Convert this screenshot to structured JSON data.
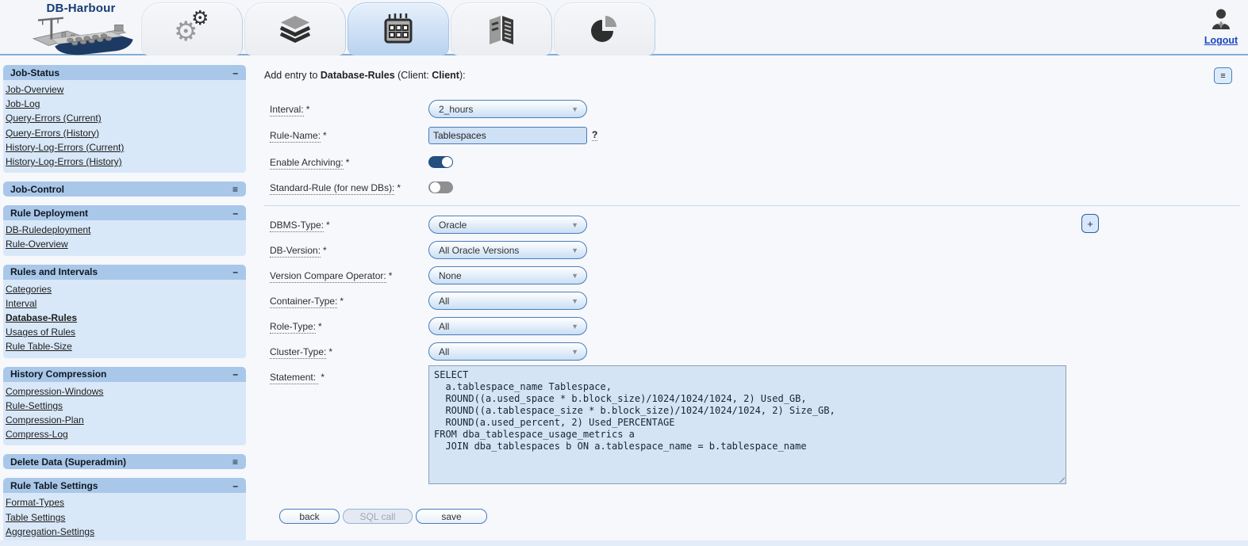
{
  "app": {
    "logo_title": "DB-Harbour",
    "logout_label": "Logout"
  },
  "icons": {
    "dropdown_arrow": "▼",
    "gear": "⚙"
  },
  "tabs": [
    {
      "name": "settings",
      "icon": "gears-icon",
      "active": false
    },
    {
      "name": "layers",
      "icon": "layers-icon",
      "active": false
    },
    {
      "name": "scheduler",
      "icon": "calendar-icon",
      "active": true
    },
    {
      "name": "ledger",
      "icon": "ledger-icon",
      "active": false
    },
    {
      "name": "statistics",
      "icon": "pie-chart-icon",
      "active": false
    }
  ],
  "sidebar": {
    "sections": [
      {
        "title": "Job-Status",
        "toggle": "–",
        "state": "expanded",
        "items": [
          "Job-Overview",
          "Job-Log",
          "Query-Errors (Current)",
          "Query-Errors (History)",
          "History-Log-Errors (Current)",
          "History-Log-Errors (History)"
        ]
      },
      {
        "title": "Job-Control",
        "toggle": "≡",
        "state": "collapsed",
        "items": []
      },
      {
        "title": "Rule Deployment",
        "toggle": "–",
        "state": "expanded",
        "items": [
          "DB-Ruledeployment",
          "Rule-Overview"
        ]
      },
      {
        "title": "Rules and Intervals",
        "toggle": "–",
        "state": "expanded",
        "items": [
          "Categories",
          "Interval",
          "Database-Rules",
          "Usages of Rules",
          "Rule Table-Size"
        ],
        "active_item": "Database-Rules"
      },
      {
        "title": "History Compression",
        "toggle": "–",
        "state": "expanded",
        "items": [
          "Compression-Windows",
          "Rule-Settings",
          "Compression-Plan",
          "Compress-Log"
        ]
      },
      {
        "title": "Delete Data (Superadmin)",
        "toggle": "≡",
        "state": "collapsed",
        "items": []
      },
      {
        "title": "Rule Table Settings",
        "toggle": "–",
        "state": "expanded",
        "items": [
          "Format-Types",
          "Table Settings",
          "Aggregation-Settings"
        ]
      }
    ]
  },
  "main": {
    "title": {
      "prefix": "Add entry to ",
      "entity": "Database-Rules",
      "mid": " (Client: ",
      "client": "Client",
      "suffix": "):"
    },
    "menu_button": "≡",
    "add_button": "+",
    "fields": {
      "interval": {
        "label": "Interval:",
        "required": "*",
        "value": "2_hours"
      },
      "rule_name": {
        "label": "Rule-Name:",
        "required": "*",
        "value": "Tablespaces",
        "help": "?"
      },
      "enable_archiving": {
        "label": "Enable Archiving:",
        "required": "*",
        "on": true
      },
      "standard_rule": {
        "label": "Standard-Rule (for new DBs):",
        "required": "*",
        "on": false
      },
      "dbms_type": {
        "label": "DBMS-Type:",
        "required": "*",
        "value": "Oracle"
      },
      "db_version": {
        "label": "DB-Version:",
        "required": "*",
        "value": "All Oracle Versions"
      },
      "version_compare_operator": {
        "label": "Version Compare Operator:",
        "required": "*",
        "value": "None"
      },
      "container_type": {
        "label": "Container-Type:",
        "required": "*",
        "value": "All"
      },
      "role_type": {
        "label": "Role-Type:",
        "required": "*",
        "value": "All"
      },
      "cluster_type": {
        "label": "Cluster-Type:",
        "required": "*",
        "value": "All"
      },
      "statement": {
        "label": "Statement: ",
        "required": "*",
        "value": "SELECT\n  a.tablespace_name Tablespace,\n  ROUND((a.used_space * b.block_size)/1024/1024/1024, 2) Used_GB,\n  ROUND((a.tablespace_size * b.block_size)/1024/1024/1024, 2) Size_GB,\n  ROUND(a.used_percent, 2) Used_PERCENTAGE\nFROM dba_tablespace_usage_metrics a\n  JOIN dba_tablespaces b ON a.tablespace_name = b.tablespace_name"
      }
    },
    "buttons": {
      "back": "back",
      "sql_call": "SQL call",
      "save": "save"
    }
  },
  "colors": {
    "accent_border": "#4a7cb8",
    "header_divider": "#84add7",
    "sidebar_header_bg": "#a9c7e9",
    "sidebar_body_bg": "#d9e8f8",
    "active_tab_bg": "#b8d2ef",
    "field_bg": "#cfe1f4",
    "statement_bg": "#d5e4f5",
    "toggle_on": "#24507f",
    "toggle_off": "#8f8f8f",
    "link_blue": "#1b45c0"
  }
}
